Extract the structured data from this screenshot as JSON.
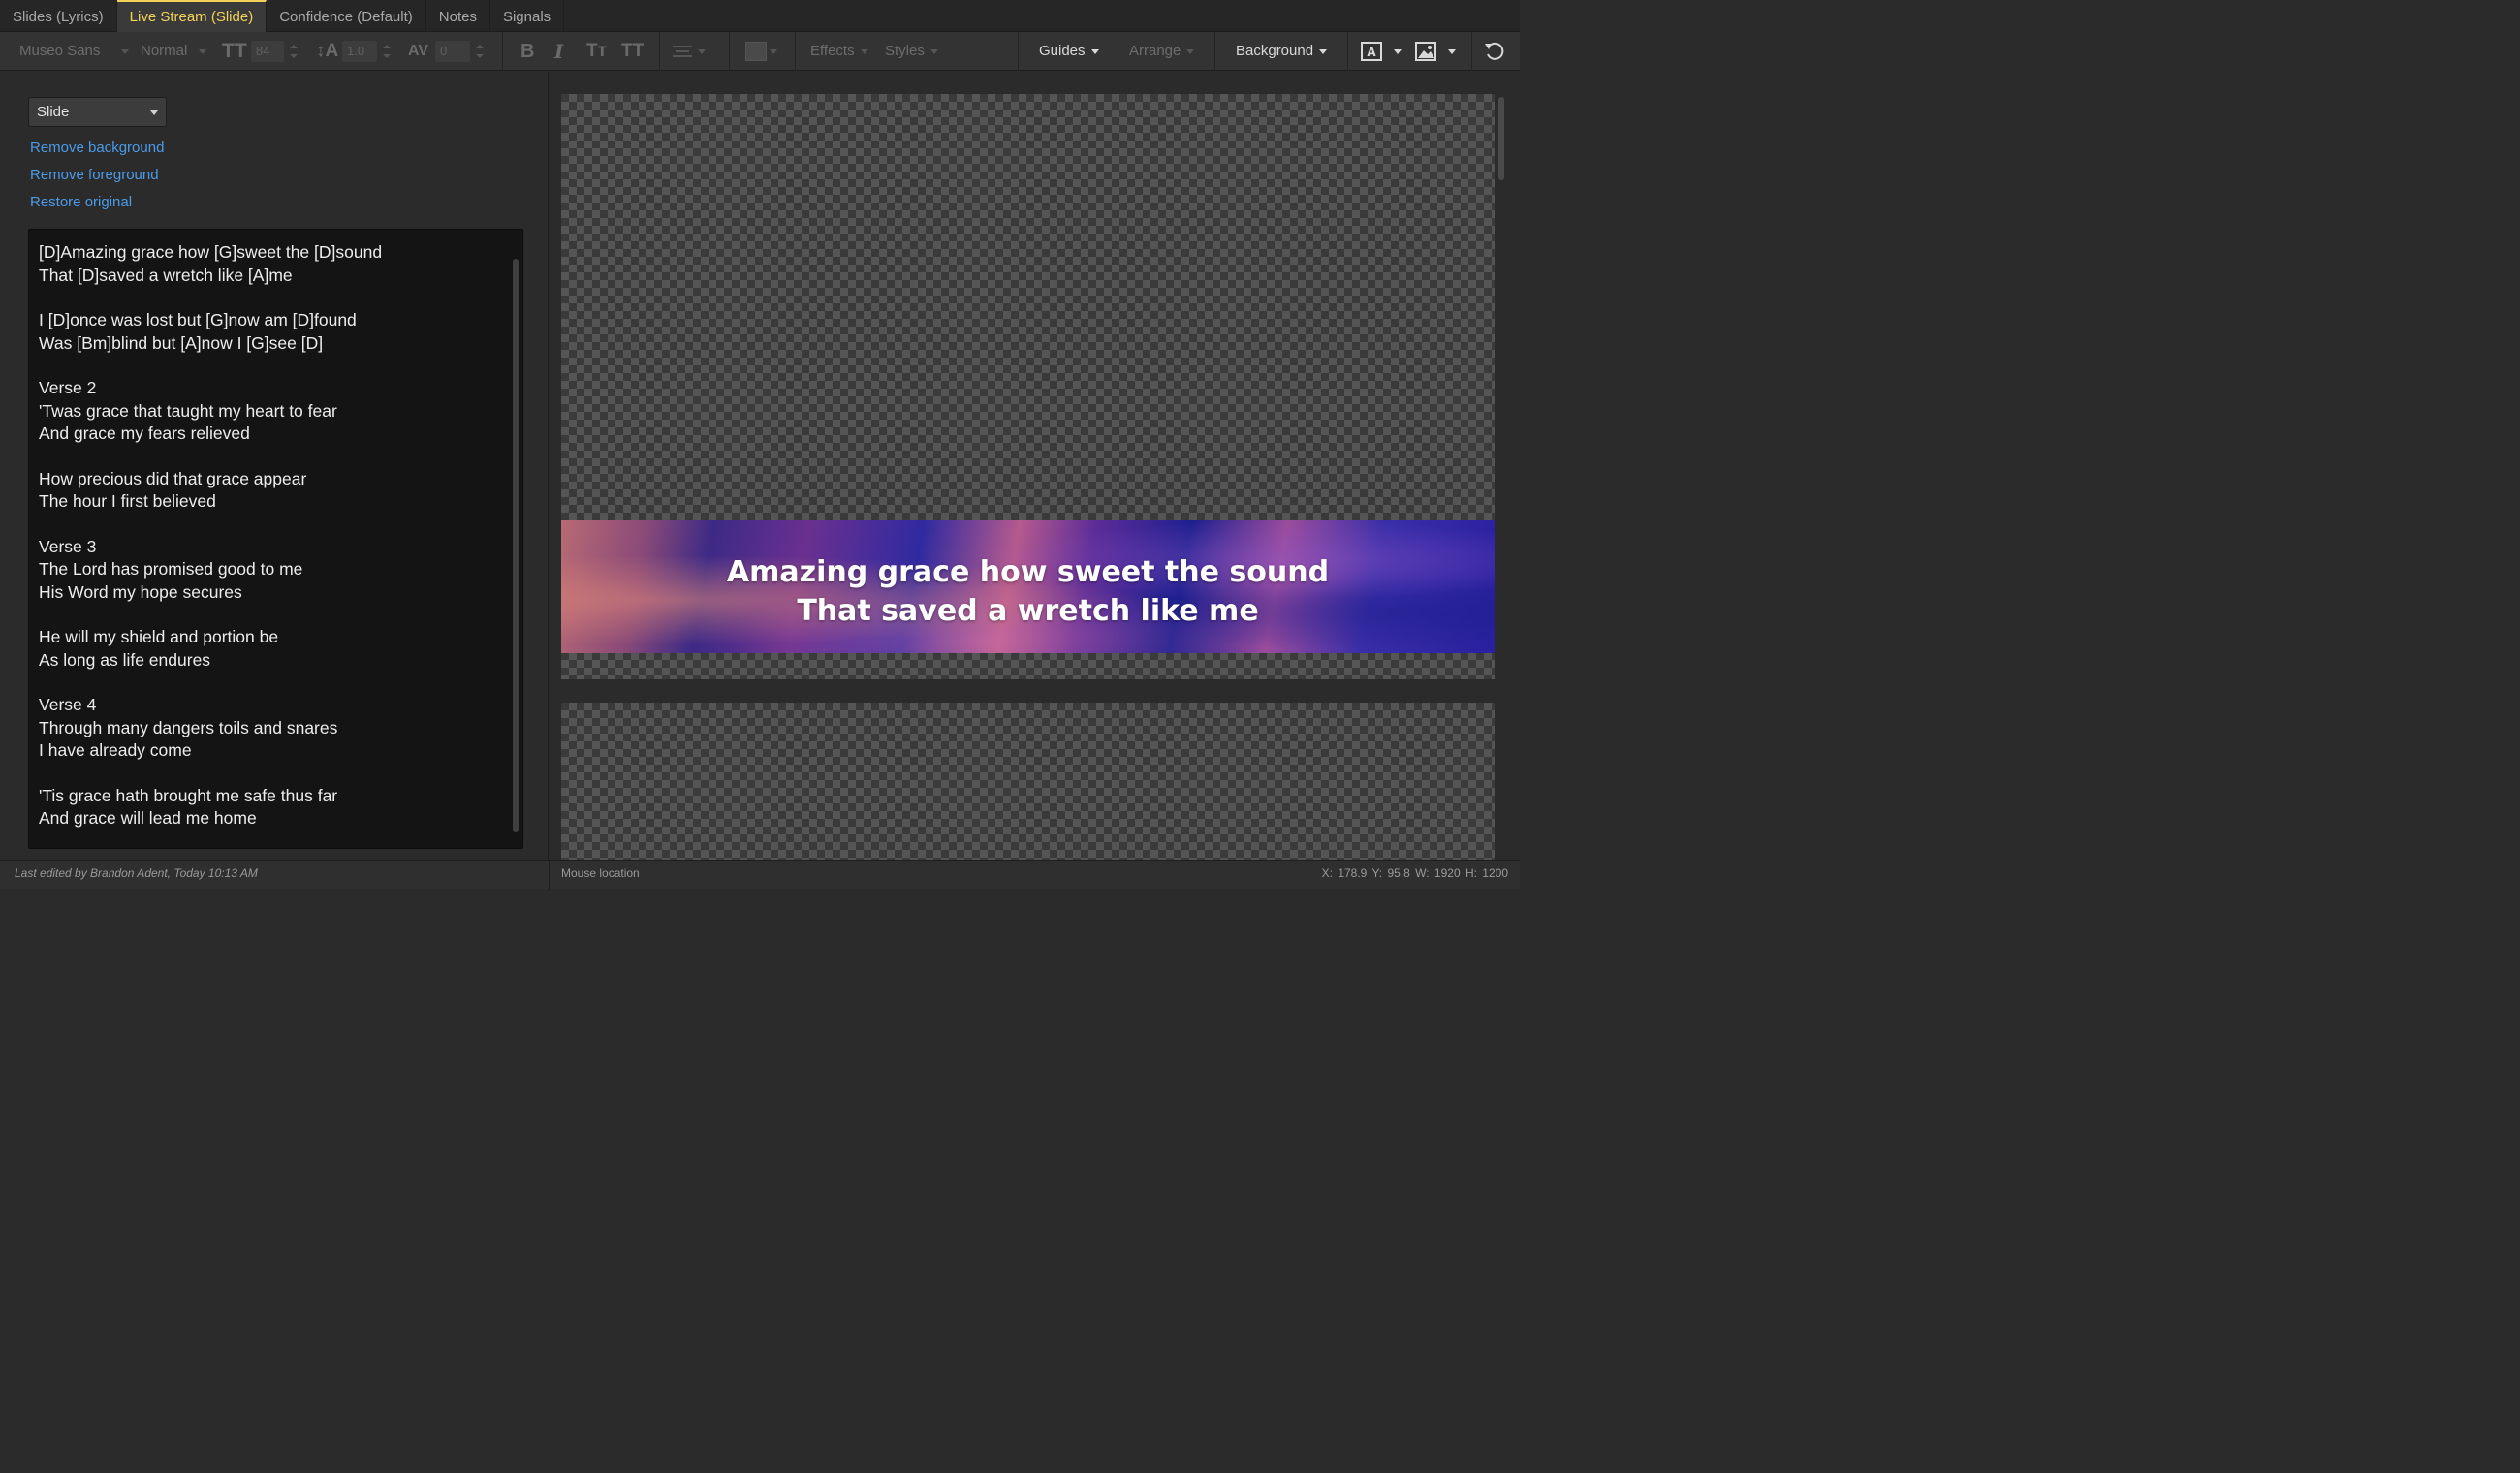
{
  "tabs": [
    {
      "label": "Slides (Lyrics)",
      "active": false
    },
    {
      "label": "Live Stream (Slide)",
      "active": true
    },
    {
      "label": "Confidence (Default)",
      "active": false
    },
    {
      "label": "Notes",
      "active": false
    },
    {
      "label": "Signals",
      "active": false
    }
  ],
  "toolbar": {
    "font_family": "Museo Sans",
    "font_style": "Normal",
    "font_size": "84",
    "line_height": "1.0",
    "char_spacing": "0",
    "effects": "Effects",
    "styles": "Styles",
    "guides": "Guides",
    "arrange": "Arrange",
    "background": "Background"
  },
  "left": {
    "layer_select": "Slide",
    "remove_background": "Remove background",
    "remove_foreground": "Remove foreground",
    "restore_original": "Restore original",
    "lyrics": [
      [
        "[D]Amazing grace how [G]sweet the [D]sound",
        "That [D]saved a wretch like [A]me"
      ],
      [
        "I [D]once was lost but [G]now am [D]found",
        "Was [Bm]blind but [A]now I [G]see [D]"
      ],
      [
        "Verse 2",
        "'Twas grace that taught my heart to fear",
        "And grace my fears relieved"
      ],
      [
        "How precious did that grace appear",
        "The hour I first believed"
      ],
      [
        "Verse 3",
        "The Lord has promised good to me",
        "His Word my hope secures"
      ],
      [
        "He will my shield and portion be",
        "As long as life endures"
      ],
      [
        "Verse 4",
        "Through many dangers toils and snares",
        "I have already come"
      ],
      [
        "'Tis grace hath brought me safe thus far",
        "And grace will lead me home"
      ]
    ]
  },
  "preview": {
    "line1": "Amazing grace how sweet the sound",
    "line2": "That saved a wretch like me"
  },
  "status": {
    "last_edited": "Last edited by Brandon Adent, Today 10:13 AM",
    "mouse_label": "Mouse location",
    "coords": "X: 178.9  Y: 95.8    W: 1920  H: 1200"
  },
  "colors": {
    "accent_tab": "#f3d25a",
    "link": "#4a9be8"
  }
}
